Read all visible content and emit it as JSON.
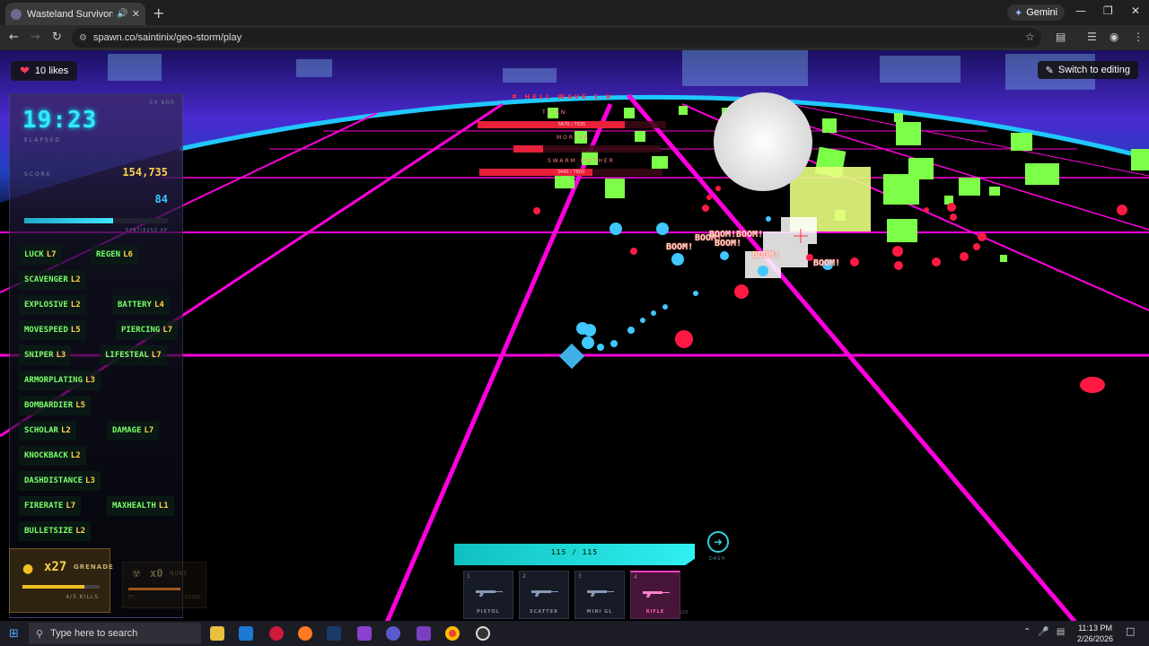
{
  "browser": {
    "tab_title": "Wasteland Survivors: Ashto",
    "url": "spawn.co/saintinix/geo-storm/play",
    "gemini_label": "Gemini"
  },
  "page": {
    "likes": "10 likes",
    "switch_editing": "Switch to editing"
  },
  "hud": {
    "timer": "19:23",
    "elapsed_label": "ELAPSED",
    "tag": "EX BRR",
    "score_label": "SCORE",
    "score": "154,735",
    "kills": "84",
    "xp_fraction": 0.62,
    "xp_text": "5797/8253 XP",
    "upgrades": [
      {
        "name": "LUCK",
        "level": "L7"
      },
      {
        "name": "REGEN",
        "level": "L6"
      },
      {
        "name": "SCAVENGER",
        "level": "L2"
      },
      {
        "name": "EXPLOSIVE",
        "level": "L2"
      },
      {
        "name": "BATTERY",
        "level": "L4"
      },
      {
        "name": "MOVESPEED",
        "level": "L5"
      },
      {
        "name": "PIERCING",
        "level": "L7"
      },
      {
        "name": "SNIPER",
        "level": "L3"
      },
      {
        "name": "LIFESTEAL",
        "level": "L7"
      },
      {
        "name": "ARMORPLATING",
        "level": "L3"
      },
      {
        "name": "BOMBARDIER",
        "level": "L5"
      },
      {
        "name": "SCHOLAR",
        "level": "L2"
      },
      {
        "name": "DAMAGE",
        "level": "L7"
      },
      {
        "name": "KNOCKBACK",
        "level": "L2"
      },
      {
        "name": "DASHDISTANCE",
        "level": "L3"
      },
      {
        "name": "FIRERATE",
        "level": "L7"
      },
      {
        "name": "MAXHEALTH",
        "level": "L1"
      },
      {
        "name": "BULLETSIZE",
        "level": "L2"
      }
    ],
    "grenade": {
      "count": "x27",
      "name": "GRENADE",
      "progress": 0.8,
      "sub": "4/5 KILLS"
    },
    "nuke": {
      "count": "x0",
      "name": "NUKE",
      "progress": 1.0,
      "key": "[F]",
      "sub": "11/100"
    },
    "wave": "HELL WAVE 1",
    "bosses": [
      {
        "name": "TITAN",
        "hp": "5670 / 7035",
        "fraction": 0.78
      },
      {
        "name": "MORTAR",
        "hp": "",
        "fraction": 0.2
      },
      {
        "name": "SWARM MOTHER",
        "hp": "3440 / 7800",
        "fraction": 0.62
      }
    ],
    "boom_text": "BOOM!",
    "ammo": "115 / 115",
    "dash_label": "DASH",
    "weapons": [
      {
        "slot": "1",
        "name": "PISTOL",
        "active": false
      },
      {
        "slot": "2",
        "name": "SCATTER",
        "active": false
      },
      {
        "slot": "3",
        "name": "MINI GL",
        "active": false
      },
      {
        "slot": "4",
        "name": "RIFLE",
        "active": true
      }
    ],
    "weapon_extra": "Q/E"
  },
  "taskbar": {
    "search_placeholder": "Type here to search",
    "time": "11:13 PM",
    "date": "2/26/2026",
    "notifications": "3"
  },
  "colors": {
    "grid": "#ff00dd",
    "cyan": "#33e8ff",
    "enemy_cube": "#7dff4a",
    "enemy_orb": "#ff1a44",
    "player_shot": "#40c8ff"
  }
}
